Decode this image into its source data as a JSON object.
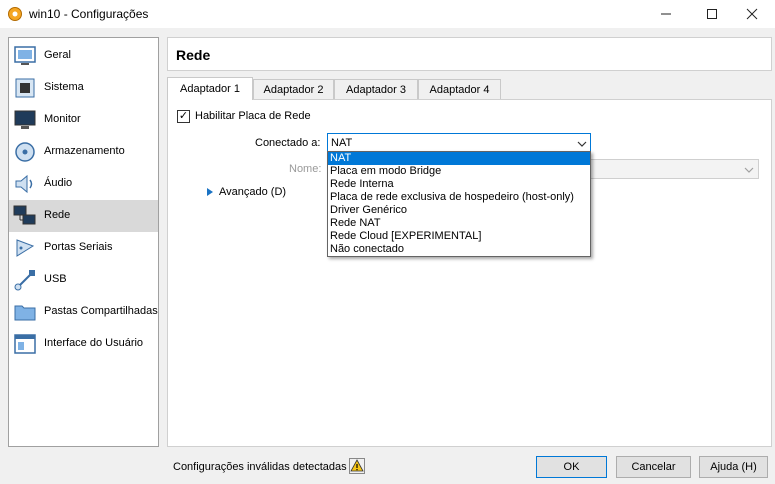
{
  "window": {
    "title": "win10 - Configurações",
    "minimize_icon": "minimize-icon",
    "maximize_icon": "maximize-icon",
    "close_icon": "close-icon"
  },
  "sidebar": {
    "items": [
      {
        "label": "Geral",
        "icon": "general-icon"
      },
      {
        "label": "Sistema",
        "icon": "system-chip-icon"
      },
      {
        "label": "Monitor",
        "icon": "display-monitor-icon"
      },
      {
        "label": "Armazenamento",
        "icon": "storage-disk-icon"
      },
      {
        "label": "Áudio",
        "icon": "speaker-icon"
      },
      {
        "label": "Rede",
        "icon": "network-icon",
        "selected": true
      },
      {
        "label": "Portas Seriais",
        "icon": "serial-port-icon"
      },
      {
        "label": "USB",
        "icon": "usb-icon"
      },
      {
        "label": "Pastas Compartilhadas",
        "icon": "shared-folder-icon"
      },
      {
        "label": "Interface do Usuário",
        "icon": "user-interface-icon"
      }
    ]
  },
  "section_title": "Rede",
  "tabs": [
    "Adaptador 1",
    "Adaptador 2",
    "Adaptador 3",
    "Adaptador 4"
  ],
  "adapter": {
    "enable_label": "Habilitar Placa de Rede",
    "enable_checked": "✓",
    "attached_label": "Conectado a:",
    "attached_value": "NAT",
    "name_label": "Nome:",
    "advanced_label": "Avançado (D)"
  },
  "dropdown_options": [
    "NAT",
    "Placa em modo Bridge",
    "Rede Interna",
    "Placa de rede exclusiva de hospedeiro (host-only)",
    "Driver Genérico",
    "Rede NAT",
    "Rede Cloud [EXPERIMENTAL]",
    "Não conectado"
  ],
  "footer": {
    "status_text": "Configurações inválidas detectadas",
    "warning_icon": "warning-icon",
    "ok_label": "OK",
    "cancel_label": "Cancelar",
    "help_label": "Ajuda (H)"
  },
  "colors": {
    "selection": "#0078d7",
    "sidebar_selected": "#d9d9d9"
  }
}
